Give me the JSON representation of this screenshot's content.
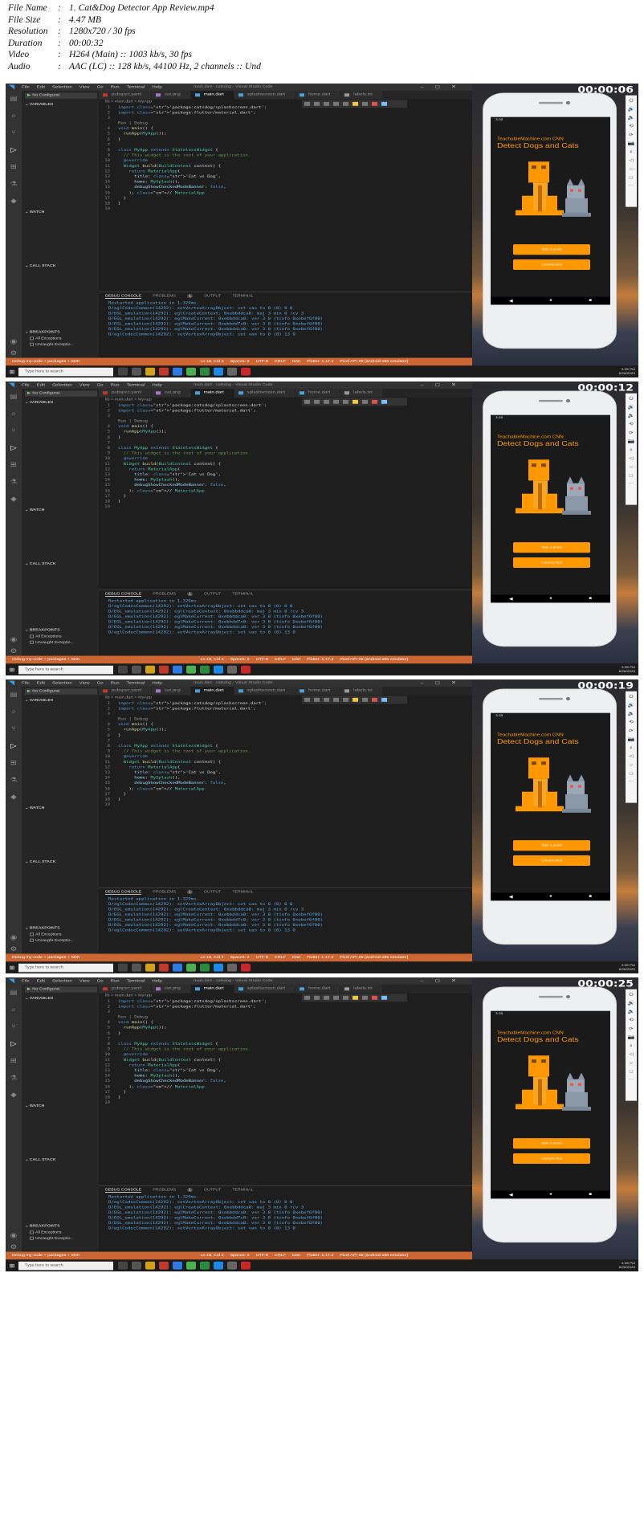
{
  "file_info": [
    {
      "key": "File Name",
      "value": "1. Cat&Dog Detector App Review.mp4"
    },
    {
      "key": "File Size",
      "value": "4.47 MB"
    },
    {
      "key": "Resolution",
      "value": "1280x720 / 30 fps"
    },
    {
      "key": "Duration",
      "value": "00:00:32"
    },
    {
      "key": "Video",
      "value": "H264 (Main) :: 1003 kb/s, 30 fps"
    },
    {
      "key": "Audio",
      "value": "AAC (LC) :: 128 kb/s, 44100 Hz, 2 channels :: Und"
    }
  ],
  "timestamps": [
    "00:00:06",
    "00:00:12",
    "00:00:19",
    "00:00:25"
  ],
  "vscode": {
    "menu": [
      "File",
      "Edit",
      "Selection",
      "View",
      "Go",
      "Run",
      "Terminal",
      "Help"
    ],
    "window_title": "main.dart - catsdog - Visual Studio Code",
    "run_config": "No Configurat",
    "sections": {
      "variables": "VARIABLES",
      "watch": "WATCH",
      "call_stack": "CALL STACK",
      "breakpoints": "BREAKPOINTS"
    },
    "breakpoints": [
      "All Exceptions",
      "Uncaught Exceptio..."
    ],
    "tabs": [
      {
        "label": "pubspec.yaml",
        "kind": "yaml"
      },
      {
        "label": "cat.png",
        "kind": "img"
      },
      {
        "label": "main.dart",
        "kind": "dart",
        "active": true
      },
      {
        "label": "splashscreen.dart",
        "kind": "dart"
      },
      {
        "label": "home.dart",
        "kind": "dart"
      },
      {
        "label": "labels.txt",
        "kind": "txt"
      }
    ],
    "breadcrumb": "lib > main.dart > MyApp",
    "code_lines": [
      {
        "n": "1",
        "t": "import 'package:catsdog/splashscreen.dart';"
      },
      {
        "n": "2",
        "t": "import 'package:flutter/material.dart';"
      },
      {
        "n": "3",
        "t": ""
      },
      {
        "n": "",
        "t": "Run | Debug"
      },
      {
        "n": "4",
        "t": "void main() {"
      },
      {
        "n": "5",
        "t": "  runApp(MyApp());"
      },
      {
        "n": "6",
        "t": "}"
      },
      {
        "n": "7",
        "t": ""
      },
      {
        "n": "8",
        "t": "class MyApp extends StatelessWidget {"
      },
      {
        "n": "9",
        "t": "  // This widget is the root of your application."
      },
      {
        "n": "10",
        "t": "  @override"
      },
      {
        "n": "11",
        "t": "  Widget build(BuildContext context) {"
      },
      {
        "n": "12",
        "t": "    return MaterialApp("
      },
      {
        "n": "13",
        "t": "      title: 'Cat vs Dog',"
      },
      {
        "n": "14",
        "t": "      home: MySplash(),"
      },
      {
        "n": "15",
        "t": "      debugShowCheckedModeBanner: false,"
      },
      {
        "n": "16",
        "t": "    ); // MaterialApp"
      },
      {
        "n": "17",
        "t": "  }"
      },
      {
        "n": "18",
        "t": "}"
      },
      {
        "n": "19",
        "t": ""
      }
    ],
    "panel_tabs": [
      "DEBUG CONSOLE",
      "PROBLEMS",
      "OUTPUT",
      "TERMINAL"
    ],
    "problems_count": "1",
    "console_lines": [
      "Restarted application in 1,329ms.",
      "D/eglCodecCommon(14292): setVertexArrayObject: set vao to 0 (0) 0 0",
      "D/EGL_emulation(14292): eglCreateContext: 0xebbddca0: maj 3 min 0 rcv 3",
      "D/EGL_emulation(14292): eglMakeCurrent: 0xebbddca0: ver 3 0 (tinfo 0xebef6f00)",
      "D/EGL_emulation(14292): eglMakeCurrent: 0xebbdd7c0: ver 3 0 (tinfo 0xebef6f00)",
      "D/EGL_emulation(14292): eglMakeCurrent: 0xebbddca0: ver 3 0 (tinfo 0xebef6f00)",
      "D/eglCodecCommon(14292): setVertexArrayObject: set vao to 0 (0) 13 0"
    ],
    "status_items": [
      "Debug my-code + packages + SDK",
      "Ln 18, Col 2",
      "Spaces: 2",
      "UTF-8",
      "CRLF",
      "Dart",
      "Flutter: 1.17.4",
      "Pixel API 28 (android-x86 emulator)"
    ]
  },
  "taskbar": {
    "search_placeholder": "Type here to search",
    "time": "3:35 PM",
    "date": "6/26/2020"
  },
  "phone": {
    "status_time": "3:35",
    "header_small": "TeachableMachine.com CNN",
    "header_big": "Detect Dogs and Cats",
    "buttons": [
      "Take a photo",
      "Camera Roll"
    ],
    "nav": [
      "◀",
      "●",
      "■"
    ]
  },
  "emulator_icons": [
    "power-icon",
    "volume-up-icon",
    "volume-down-icon",
    "rotate-left-icon",
    "rotate-right-icon",
    "camera-icon",
    "zoom-icon",
    "back-icon",
    "home-icon",
    "overview-icon",
    "more-icon"
  ],
  "colors": {
    "accent": "#ff9800",
    "statusbar": "#cc6633",
    "editor_bg": "#1e1e1e"
  }
}
